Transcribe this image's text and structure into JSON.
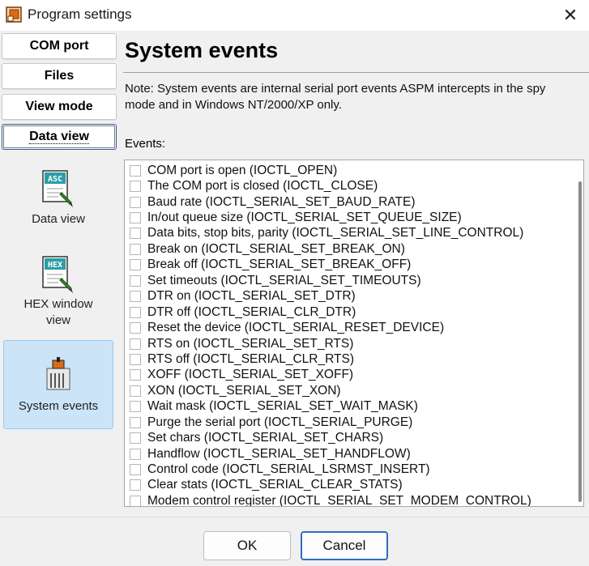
{
  "window": {
    "title": "Program settings",
    "icon": "app-icon",
    "close_label": "✕"
  },
  "sidebar": {
    "nav_buttons": [
      {
        "label": "COM port"
      },
      {
        "label": "Files"
      },
      {
        "label": "View mode"
      },
      {
        "label": "Data view",
        "active": true
      }
    ],
    "view_tiles": [
      {
        "label": "Data view",
        "icon": "asc-document-icon",
        "icon_text": "ASC"
      },
      {
        "label": "HEX window view",
        "icon": "hex-document-icon",
        "icon_text": "HEX"
      },
      {
        "label": "System events",
        "icon": "system-events-icon",
        "selected": true
      }
    ]
  },
  "main": {
    "title": "System events",
    "note": "Note: System events are internal serial port events ASPM intercepts in the spy mode and in Windows NT/2000/XP only.",
    "events_label": "Events:",
    "events": [
      {
        "label": "COM port is open (IOCTL_OPEN)",
        "checked": false
      },
      {
        "label": "The COM port is closed (IOCTL_CLOSE)",
        "checked": false
      },
      {
        "label": "Baud rate (IOCTL_SERIAL_SET_BAUD_RATE)",
        "checked": false
      },
      {
        "label": "In/out queue size (IOCTL_SERIAL_SET_QUEUE_SIZE)",
        "checked": false
      },
      {
        "label": "Data bits, stop bits, parity (IOCTL_SERIAL_SET_LINE_CONTROL)",
        "checked": false
      },
      {
        "label": "Break on (IOCTL_SERIAL_SET_BREAK_ON)",
        "checked": false
      },
      {
        "label": "Break off (IOCTL_SERIAL_SET_BREAK_OFF)",
        "checked": false
      },
      {
        "label": "Set timeouts (IOCTL_SERIAL_SET_TIMEOUTS)",
        "checked": false
      },
      {
        "label": "DTR on (IOCTL_SERIAL_SET_DTR)",
        "checked": false
      },
      {
        "label": "DTR off (IOCTL_SERIAL_CLR_DTR)",
        "checked": false
      },
      {
        "label": "Reset the device (IOCTL_SERIAL_RESET_DEVICE)",
        "checked": false
      },
      {
        "label": "RTS on (IOCTL_SERIAL_SET_RTS)",
        "checked": false
      },
      {
        "label": "RTS off (IOCTL_SERIAL_CLR_RTS)",
        "checked": false
      },
      {
        "label": "XOFF (IOCTL_SERIAL_SET_XOFF)",
        "checked": false
      },
      {
        "label": "XON (IOCTL_SERIAL_SET_XON)",
        "checked": false
      },
      {
        "label": "Wait mask (IOCTL_SERIAL_SET_WAIT_MASK)",
        "checked": false
      },
      {
        "label": "Purge the serial port (IOCTL_SERIAL_PURGE)",
        "checked": false
      },
      {
        "label": "Set chars (IOCTL_SERIAL_SET_CHARS)",
        "checked": false
      },
      {
        "label": "Handflow (IOCTL_SERIAL_SET_HANDFLOW)",
        "checked": false
      },
      {
        "label": "Control code (IOCTL_SERIAL_LSRMST_INSERT)",
        "checked": false
      },
      {
        "label": "Clear stats (IOCTL_SERIAL_CLEAR_STATS)",
        "checked": false
      },
      {
        "label": "Modem control register (IOCTL_SERIAL_SET_MODEM_CONTROL)",
        "checked": false
      }
    ]
  },
  "footer": {
    "ok_label": "OK",
    "cancel_label": "Cancel"
  },
  "colors": {
    "accent": "#2f6fc3",
    "selected_tile_bg": "#cce4f7"
  }
}
